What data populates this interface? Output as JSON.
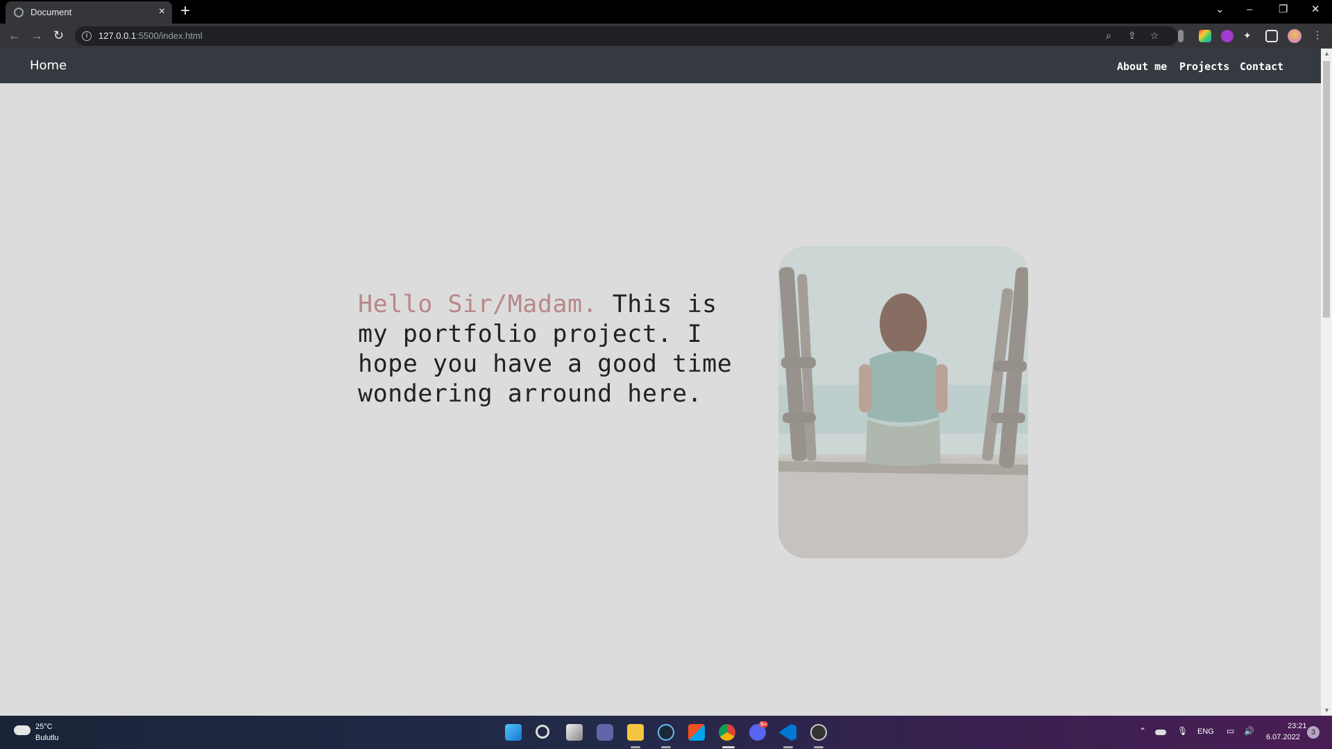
{
  "browser": {
    "tab_title": "Document",
    "tab_close": "×",
    "new_tab": "+",
    "url_host": "127.0.0.1",
    "url_rest": ":5500/index.html",
    "window_controls": {
      "minimize": "–",
      "restore": "❐",
      "close": "✕",
      "tab_search": "⌄"
    }
  },
  "site": {
    "brand": "Home",
    "nav_links": [
      "About me",
      "Projects",
      "Contact"
    ],
    "hero": {
      "greeting": "Hello Sir/Madam.",
      "body": " This is my portfolio project. I hope you have a good time wondering arround here."
    }
  },
  "taskbar": {
    "weather_temp": "25°C",
    "weather_condition": "Bulutlu",
    "language": "ENG",
    "time": "23:21",
    "date": "6.07.2022",
    "notification_count": "3",
    "discord_badge": "9+"
  },
  "colors": {
    "navbar": "#343a40",
    "page_bg": "#dcdcdc",
    "greeting_accent": "#b98787"
  }
}
